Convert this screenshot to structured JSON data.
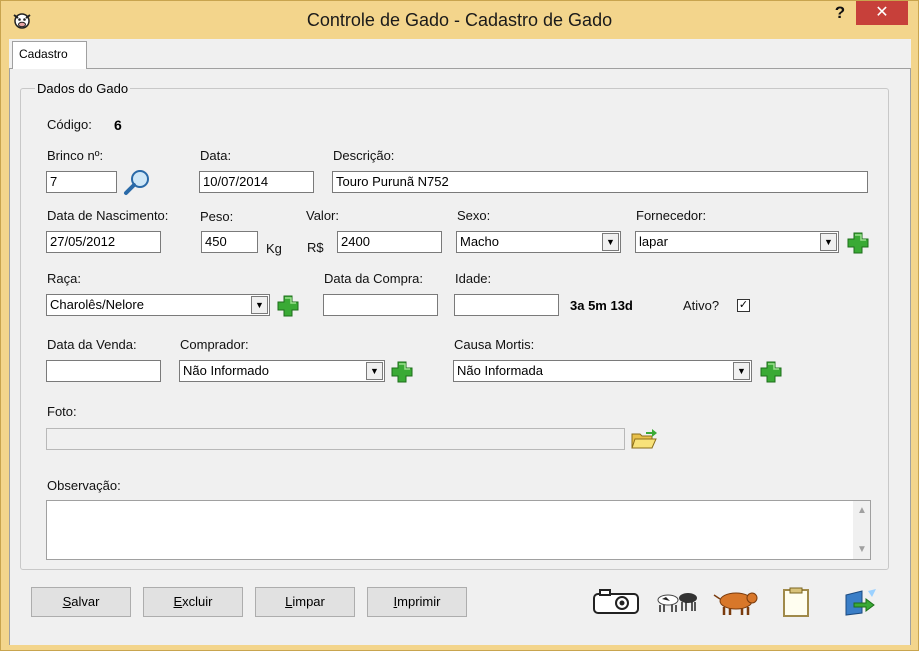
{
  "window": {
    "title": "Controle de Gado - Cadastro de Gado",
    "help_label": "?",
    "close_label": "✕",
    "app_icon": "cow-face-icon"
  },
  "tabs": [
    {
      "label": "Cadastro"
    }
  ],
  "group": {
    "legend": "Dados do Gado"
  },
  "form": {
    "codigo": {
      "label": "Código:",
      "value": "6"
    },
    "brinco": {
      "label": "Brinco nº:",
      "value": "7"
    },
    "data": {
      "label": "Data:",
      "value": "10/07/2014"
    },
    "descricao": {
      "label": "Descrição:",
      "value": "Touro Purunã N752"
    },
    "nascimento": {
      "label": "Data de Nascimento:",
      "value": "27/05/2012"
    },
    "peso": {
      "label": "Peso:",
      "value": "450",
      "unit": "Kg"
    },
    "valor": {
      "label": "Valor:",
      "value": "2400",
      "unit": "R$"
    },
    "sexo": {
      "label": "Sexo:",
      "value": "Macho"
    },
    "fornecedor": {
      "label": "Fornecedor:",
      "value": "lapar"
    },
    "raca": {
      "label": "Raça:",
      "value": "Charolês/Nelore"
    },
    "data_compra": {
      "label": "Data da Compra:",
      "value": ""
    },
    "idade": {
      "label": "Idade:",
      "value": "",
      "computed": "3a 5m 13d"
    },
    "ativo": {
      "label": "Ativo?",
      "checked": true,
      "mark": "✓"
    },
    "data_venda": {
      "label": "Data da Venda:",
      "value": ""
    },
    "comprador": {
      "label": "Comprador:",
      "value": "Não Informado"
    },
    "causa_mortis": {
      "label": "Causa Mortis:",
      "value": "Não Informada"
    },
    "foto": {
      "label": "Foto:",
      "value": ""
    },
    "observacao": {
      "label": "Observação:",
      "value": ""
    }
  },
  "buttons": {
    "salvar": {
      "accel": "S",
      "rest": "alvar"
    },
    "excluir": {
      "accel": "E",
      "rest": "xcluir"
    },
    "limpar": {
      "accel": "L",
      "rest": "impar"
    },
    "imprimir": {
      "accel": "I",
      "rest": "mprimir"
    }
  },
  "toolbar_icons": [
    "camera-icon",
    "cattle-icon",
    "bull-icon",
    "clipboard-icon",
    "export-icon"
  ],
  "colors": {
    "title_bar": "#f3d58c",
    "close": "#c7403a",
    "plus": "#3aaa35"
  }
}
